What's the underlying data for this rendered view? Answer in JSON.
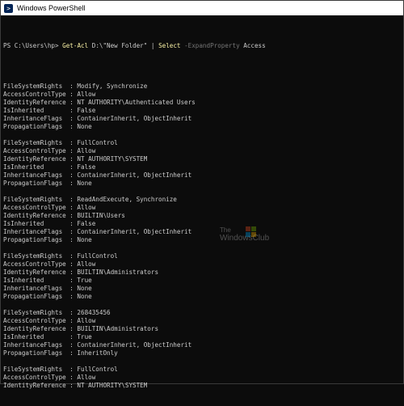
{
  "window": {
    "title": "Windows PowerShell",
    "icon": "powershell-icon",
    "icon_glyph": ">"
  },
  "console": {
    "prompt": "PS C:\\Users\\hp> ",
    "command": {
      "cmdlet1": "Get-Acl",
      "arg1": " D:\\",
      "arg1_string": "\"New Folder\"",
      "pipe": " | ",
      "cmdlet2": "Select",
      "param": " -ExpandProperty",
      "value": " Access"
    },
    "lines": [
      "",
      "",
      "FileSystemRights  : Modify, Synchronize",
      "AccessControlType : Allow",
      "IdentityReference : NT AUTHORITY\\Authenticated Users",
      "IsInherited       : False",
      "InheritanceFlags  : ContainerInherit, ObjectInherit",
      "PropagationFlags  : None",
      "",
      "FileSystemRights  : FullControl",
      "AccessControlType : Allow",
      "IdentityReference : NT AUTHORITY\\SYSTEM",
      "IsInherited       : False",
      "InheritanceFlags  : ContainerInherit, ObjectInherit",
      "PropagationFlags  : None",
      "",
      "FileSystemRights  : ReadAndExecute, Synchronize",
      "AccessControlType : Allow",
      "IdentityReference : BUILTIN\\Users",
      "IsInherited       : False",
      "InheritanceFlags  : ContainerInherit, ObjectInherit",
      "PropagationFlags  : None",
      "",
      "FileSystemRights  : FullControl",
      "AccessControlType : Allow",
      "IdentityReference : BUILTIN\\Administrators",
      "IsInherited       : True",
      "InheritanceFlags  : None",
      "PropagationFlags  : None",
      "",
      "FileSystemRights  : 268435456",
      "AccessControlType : Allow",
      "IdentityReference : BUILTIN\\Administrators",
      "IsInherited       : True",
      "InheritanceFlags  : ContainerInherit, ObjectInherit",
      "PropagationFlags  : InheritOnly",
      "",
      "FileSystemRights  : FullControl",
      "AccessControlType : Allow",
      "IdentityReference : NT AUTHORITY\\SYSTEM"
    ]
  },
  "watermark": {
    "line1": "The",
    "line2": "WindowsClub",
    "logo": "windows-logo-icon"
  },
  "colors": {
    "background": "#0c0c0c",
    "text": "#cccccc",
    "cmdlet": "#f9f1a5",
    "parameter": "#767676"
  }
}
